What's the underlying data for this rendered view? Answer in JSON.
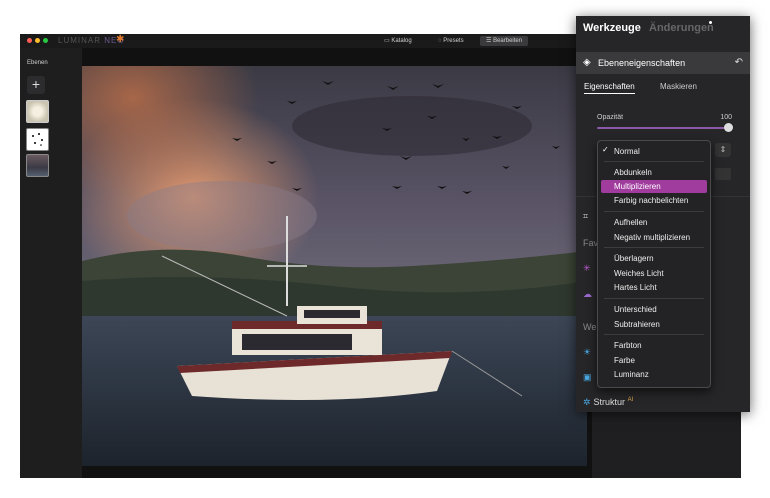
{
  "app": {
    "brand": "LUMINAR",
    "brand_suffix": "NEO",
    "tabs": [
      {
        "icon": "catalog-icon",
        "label": "Katalog"
      },
      {
        "icon": "presets-icon",
        "label": "Presets"
      },
      {
        "icon": "edit-icon",
        "label": "Bearbeiten"
      }
    ]
  },
  "layers": {
    "title": "Ebenen",
    "add_label": "+"
  },
  "panel": {
    "tab_tools": "Werkzeuge",
    "tab_changes": "Änderungen",
    "section_title": "Ebeneneigenschaften",
    "subtab_properties": "Eigenschaften",
    "subtab_mask": "Maskieren",
    "opacity_label": "Opazität",
    "opacity_value": "100",
    "side_labels": [
      "Fav",
      "We"
    ],
    "structure_label": "Struktur",
    "structure_badge": "AI"
  },
  "blend_menu": {
    "items": [
      {
        "label": "Normal",
        "checked": true,
        "selected": false
      },
      {
        "label": "Abdunkeln",
        "checked": false,
        "selected": false
      },
      {
        "label": "Multiplizieren",
        "checked": false,
        "selected": true
      },
      {
        "label": "Farbig nachbelichten",
        "checked": false,
        "selected": false
      },
      {
        "label": "Aufhellen",
        "checked": false,
        "selected": false
      },
      {
        "label": "Negativ multiplizieren",
        "checked": false,
        "selected": false
      },
      {
        "label": "Überlagern",
        "checked": false,
        "selected": false
      },
      {
        "label": "Weiches Licht",
        "checked": false,
        "selected": false
      },
      {
        "label": "Hartes Licht",
        "checked": false,
        "selected": false
      },
      {
        "label": "Unterschied",
        "checked": false,
        "selected": false
      },
      {
        "label": "Subtrahieren",
        "checked": false,
        "selected": false
      },
      {
        "label": "Farbton",
        "checked": false,
        "selected": false
      },
      {
        "label": "Farbe",
        "checked": false,
        "selected": false
      },
      {
        "label": "Luminanz",
        "checked": false,
        "selected": false
      }
    ]
  },
  "colors": {
    "accent": "#a03c9e",
    "slider": "#8a5aa8",
    "panel_bg": "#262628"
  }
}
